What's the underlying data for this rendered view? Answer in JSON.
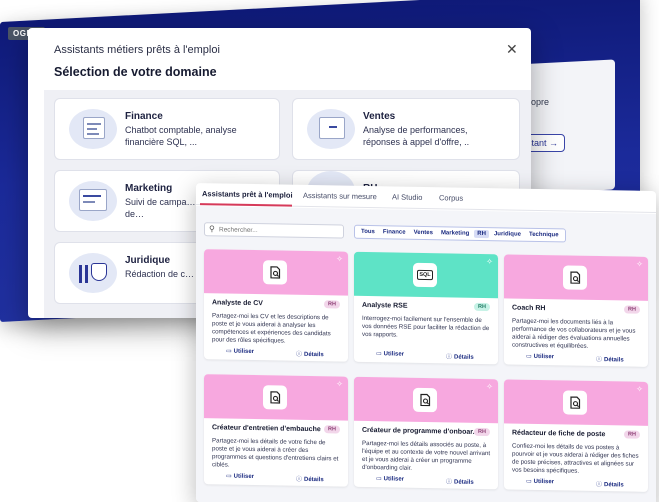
{
  "back_app": {
    "logo": "OGMA",
    "panel_text": "propre",
    "panel_button": "stant →"
  },
  "modal": {
    "title": "Assistants métiers prêts à l'emploi",
    "subtitle": "Sélection de votre domaine",
    "close_glyph": "✕",
    "domains": [
      {
        "name": "Finance",
        "desc": "Chatbot comptable, analyse financière SQL, ..."
      },
      {
        "name": "Ventes",
        "desc": "Analyse de performances, réponses à appel d'offre, .."
      },
      {
        "name": "Marketing",
        "desc": "Suivi de campa… générateurs de…"
      },
      {
        "name": "RH",
        "desc": ""
      },
      {
        "name": "Juridique",
        "desc": "Rédaction de c… juridique, ..."
      }
    ]
  },
  "front": {
    "tabs": [
      {
        "label": "Assistants prêt à l'emploi",
        "active": true
      },
      {
        "label": "Assistants sur mesure",
        "active": false
      },
      {
        "label": "AI Studio",
        "active": false
      },
      {
        "label": "Corpus",
        "active": false
      }
    ],
    "search": {
      "placeholder": "Rechercher..."
    },
    "filters": [
      {
        "label": "Tous",
        "active": false
      },
      {
        "label": "Finance",
        "active": false
      },
      {
        "label": "Ventes",
        "active": false
      },
      {
        "label": "Marketing",
        "active": false
      },
      {
        "label": "RH",
        "active": true
      },
      {
        "label": "Juridique",
        "active": false
      },
      {
        "label": "Technique",
        "active": false
      }
    ],
    "action_use": "Utiliser",
    "action_details": "Détails",
    "cards": [
      {
        "title": "Analyste de CV",
        "badge": "RH",
        "banner_color": "#f7a8df",
        "icon": "doc-search-icon",
        "desc": "Partagez-moi les CV et les descriptions de poste et je vous aiderai à analyser les compétences et expériences des candidats pour des rôles spécifiques."
      },
      {
        "title": "Analyste RSE",
        "badge": "RH",
        "banner_color": "#5ee3c6",
        "icon": "sql-icon",
        "icon_text": "SQL",
        "desc": "Interrogez-moi facilement sur l'ensemble de vos données RSE pour faciliter la rédaction de vos rapports."
      },
      {
        "title": "Coach RH",
        "badge": "RH",
        "banner_color": "#f7a8df",
        "icon": "doc-search-icon",
        "desc": "Partagez-moi les documents liés à la performance de vos collaborateurs et je vous aiderai à rédiger des évaluations annuelles constructives et équilibrées."
      },
      {
        "title": "Créateur d'entretien d'embauche",
        "badge": "RH",
        "banner_color": "#f7a8df",
        "icon": "doc-search-icon",
        "desc": "Partagez-moi les détails de votre fiche de poste et je vous aiderai à créer des programmes et questions d'entretiens clairs et ciblés."
      },
      {
        "title": "Créateur de programme d'onboar...",
        "badge": "RH",
        "banner_color": "#f7a8df",
        "icon": "doc-search-icon",
        "desc": "Partagez-moi les détails associés au poste, à l'équipe et au contexte de votre nouvel arrivant et je vous aiderai à créer un programme d'onboarding clair."
      },
      {
        "title": "Rédacteur de fiche de poste",
        "badge": "RH",
        "banner_color": "#f7a8df",
        "icon": "doc-search-icon",
        "desc": "Confiez-moi les détails de vos postes à pourvoir et je vous aiderai à rédiger des fiches de poste précises, attractives et alignées sur vos besoins spécifiques."
      }
    ]
  }
}
